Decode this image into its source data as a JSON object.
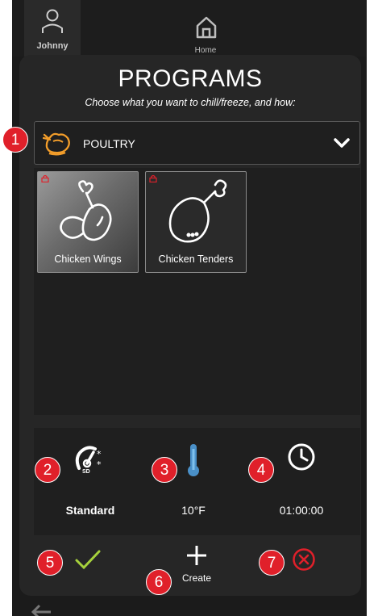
{
  "user": {
    "name": "Johnny"
  },
  "nav": {
    "home_label": "Home"
  },
  "header": {
    "title": "PROGRAMS",
    "subtitle": "Choose what you want to chill/freeze, and how:"
  },
  "category": {
    "label": "POULTRY",
    "icon": "poultry-icon",
    "accent": "#f29d2a"
  },
  "products": [
    {
      "name": "Chicken Wings",
      "icon": "chicken-wing-icon",
      "selected": true
    },
    {
      "name": "Chicken Tenders",
      "icon": "chicken-leg-icon",
      "selected": false
    }
  ],
  "settings": {
    "mode": {
      "value": "Standard",
      "icon": "soft-chill-gauge-icon",
      "icon_text": "SD"
    },
    "temperature": {
      "value": "10°F",
      "icon": "thermometer-icon"
    },
    "time": {
      "value": "01:00:00",
      "icon": "clock-icon"
    }
  },
  "actions": {
    "confirm": {
      "icon": "checkmark-icon",
      "color": "#a6d13c"
    },
    "create": {
      "label": "Create",
      "icon": "plus-icon"
    },
    "cancel": {
      "icon": "cancel-icon",
      "color": "#e0202a"
    }
  },
  "annotations": [
    "1",
    "2",
    "3",
    "4",
    "5",
    "6",
    "7"
  ]
}
